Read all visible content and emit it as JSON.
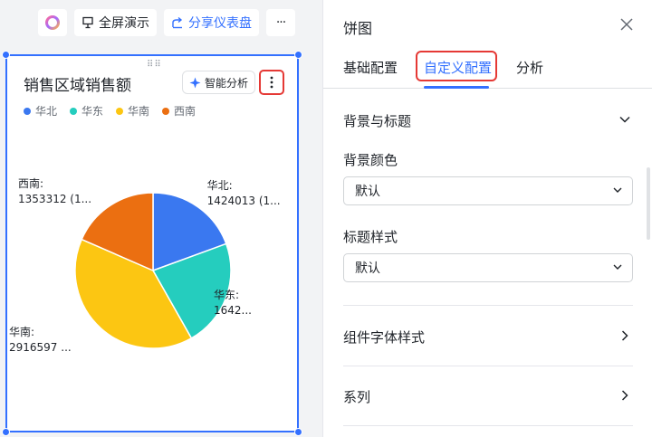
{
  "toolbar": {
    "logo_icon": "brand-ring-icon",
    "fullscreen_label": "全屏演示",
    "share_label": "分享仪表盘",
    "more_label": "···"
  },
  "card": {
    "title": "销售区域销售额",
    "ai_label": "智能分析",
    "more_icon": "vertical-ellipsis-icon"
  },
  "chart_data": {
    "type": "pie",
    "title": "销售区域销售额",
    "legend_position": "top-left",
    "categories": [
      "华北",
      "华东",
      "华南",
      "西南"
    ],
    "values": [
      1424013,
      1642000,
      2916597,
      1353312
    ],
    "colors": [
      "#3a78f0",
      "#25cdbe",
      "#fcc612",
      "#eb6f11"
    ],
    "labels": [
      "华北:\n1424013 (1...",
      "华东:\n1642...",
      "华南:\n2916597 ...",
      "西南:\n1353312 (1..."
    ]
  },
  "panel": {
    "title": "饼图",
    "tabs": [
      {
        "label": "基础配置"
      },
      {
        "label": "自定义配置"
      },
      {
        "label": "分析"
      }
    ],
    "sections": {
      "bg_title": "背景与标题",
      "bg_color_label": "背景颜色",
      "bg_color_value": "默认",
      "title_style_label": "标题样式",
      "title_style_value": "默认",
      "font_style": "组件字体样式",
      "series": "系列"
    }
  },
  "colors": {
    "accent": "#3370ff",
    "highlight": "#e53935"
  }
}
